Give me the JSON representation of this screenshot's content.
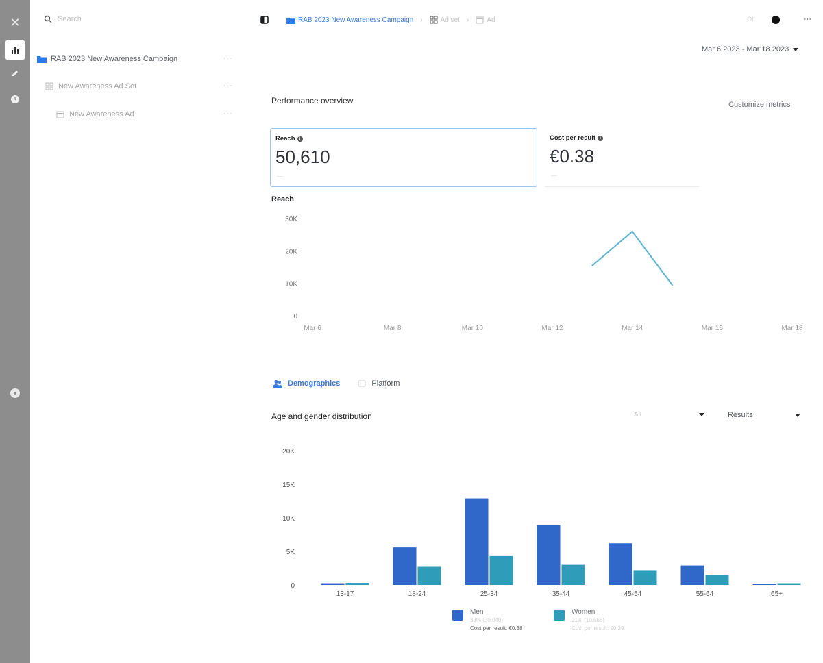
{
  "search": {
    "placeholder": "Search"
  },
  "tree": [
    {
      "label": "RAB 2023 New Awareness Campaign",
      "icon": "folder-icon",
      "selected": true
    },
    {
      "label": "New Awareness Ad Set",
      "icon": "adset-icon",
      "selected": false
    },
    {
      "label": "New Awareness Ad",
      "icon": "ad-icon",
      "selected": false
    }
  ],
  "breadcrumb": {
    "campaign": "RAB 2023 New Awareness Campaign",
    "adset": "Ad set",
    "ad": "Ad"
  },
  "topbar": {
    "toggle": "Off"
  },
  "date_range": {
    "label": "Mar 6 2023 - Mar 18 2023"
  },
  "performance": {
    "title": "Performance overview",
    "customize": "Customize metrics",
    "kpis": [
      {
        "label": "Reach",
        "value": "50,610",
        "sub": "—"
      },
      {
        "label": "Cost per result",
        "value": "€0.38",
        "sub": "—"
      }
    ]
  },
  "reach_chart": {
    "title": "Reach",
    "y_ticks": [
      "30K",
      "20K",
      "10K",
      "0"
    ],
    "x_ticks": [
      "Mar 6",
      "Mar 8",
      "Mar 10",
      "Mar 12",
      "Mar 14",
      "Mar 16",
      "Mar 18"
    ]
  },
  "tabs": [
    {
      "label": "Demographics",
      "icon": "people-icon",
      "active": true
    },
    {
      "label": "Platform",
      "icon": "platform-icon",
      "active": false
    }
  ],
  "age_gender": {
    "title": "Age and gender distribution",
    "filter": "All",
    "metric": "Results",
    "y_ticks": [
      "20K",
      "15K",
      "10K",
      "5K",
      "0"
    ]
  },
  "legend": [
    {
      "name": "Men",
      "sub1": "33% (30,040)",
      "sub2": "Cost per result: €0.38",
      "color": "#2f68c9"
    },
    {
      "name": "Women",
      "sub1": "21% (10,566)",
      "sub2": "Cost per result: €0.39",
      "color": "#2f9cba"
    }
  ],
  "colors": {
    "men": "#2f68c9",
    "women": "#2f9cba",
    "line": "#5ab4d0",
    "accent": "#3b7be0"
  },
  "chart_data": [
    {
      "type": "line",
      "title": "Reach",
      "x": [
        "Mar 13",
        "Mar 14",
        "Mar 15"
      ],
      "series": [
        {
          "values": [
            15500,
            26000,
            9500
          ]
        }
      ],
      "x_ticks": [
        "Mar 6",
        "Mar 8",
        "Mar 10",
        "Mar 12",
        "Mar 14",
        "Mar 16",
        "Mar 18"
      ],
      "ylim": [
        0,
        30000
      ],
      "grid": false
    },
    {
      "type": "bar",
      "title": "Age and gender distribution",
      "categories": [
        "13-17",
        "18-24",
        "25-34",
        "35-44",
        "45-54",
        "55-64",
        "65+"
      ],
      "series": [
        {
          "name": "Men",
          "values": [
            250,
            5600,
            12900,
            8900,
            6200,
            2900,
            200
          ]
        },
        {
          "name": "Women",
          "values": [
            300,
            2700,
            4300,
            3000,
            2200,
            1500,
            250
          ]
        }
      ],
      "ylim": [
        0,
        20000
      ],
      "grid": false
    }
  ]
}
